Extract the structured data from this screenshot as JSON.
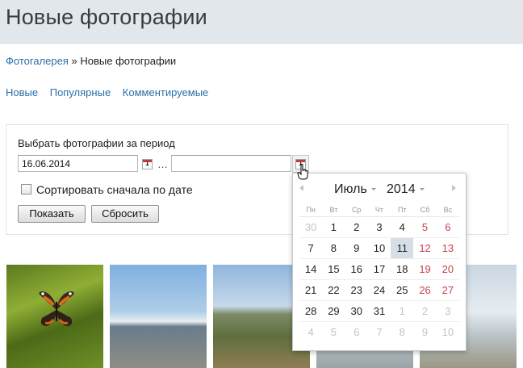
{
  "header": {
    "title": "Новые фотографии"
  },
  "breadcrumb": {
    "root": "Фотогалерея",
    "separator": "»",
    "current": "Новые фотографии"
  },
  "filter_tabs": [
    "Новые",
    "Популярные",
    "Комментируемые"
  ],
  "period": {
    "label": "Выбрать фотографии за период",
    "from_value": "16.06.2014",
    "to_value": "",
    "separator": "…",
    "calendar_icon_text": "1",
    "sort_label": "Сортировать сначала по дате",
    "sort_checked": false,
    "show_button": "Показать",
    "reset_button": "Сбросить"
  },
  "calendar": {
    "month": "Июль",
    "year": "2014",
    "weekdays": [
      "Пн",
      "Вт",
      "Ср",
      "Чт",
      "Пт",
      "Сб",
      "Вс"
    ],
    "weeks": [
      [
        {
          "d": "30",
          "other": true
        },
        {
          "d": "1"
        },
        {
          "d": "2"
        },
        {
          "d": "3"
        },
        {
          "d": "4"
        },
        {
          "d": "5",
          "we": true
        },
        {
          "d": "6",
          "we": true
        }
      ],
      [
        {
          "d": "7"
        },
        {
          "d": "8"
        },
        {
          "d": "9"
        },
        {
          "d": "10"
        },
        {
          "d": "11",
          "today": true
        },
        {
          "d": "12",
          "we": true
        },
        {
          "d": "13",
          "we": true
        }
      ],
      [
        {
          "d": "14"
        },
        {
          "d": "15"
        },
        {
          "d": "16"
        },
        {
          "d": "17"
        },
        {
          "d": "18"
        },
        {
          "d": "19",
          "we": true
        },
        {
          "d": "20",
          "we": true
        }
      ],
      [
        {
          "d": "21"
        },
        {
          "d": "22"
        },
        {
          "d": "23"
        },
        {
          "d": "24"
        },
        {
          "d": "25"
        },
        {
          "d": "26",
          "we": true
        },
        {
          "d": "27",
          "we": true
        }
      ],
      [
        {
          "d": "28"
        },
        {
          "d": "29"
        },
        {
          "d": "30"
        },
        {
          "d": "31"
        },
        {
          "d": "1",
          "other": true
        },
        {
          "d": "2",
          "other": true
        },
        {
          "d": "3",
          "other": true
        }
      ],
      [
        {
          "d": "4",
          "other": true
        },
        {
          "d": "5",
          "other": true
        },
        {
          "d": "6",
          "other": true
        },
        {
          "d": "7",
          "other": true
        },
        {
          "d": "8",
          "other": true
        },
        {
          "d": "9",
          "other": true
        },
        {
          "d": "10",
          "other": true
        }
      ]
    ]
  },
  "photos": [
    "butterfly",
    "pier",
    "fort",
    "harbor",
    "shore"
  ],
  "colors": {
    "link": "#2a6fa8",
    "weekend": "#c9424b",
    "today_bg": "#d6dee8",
    "header_bg": "#e1e7eb"
  }
}
